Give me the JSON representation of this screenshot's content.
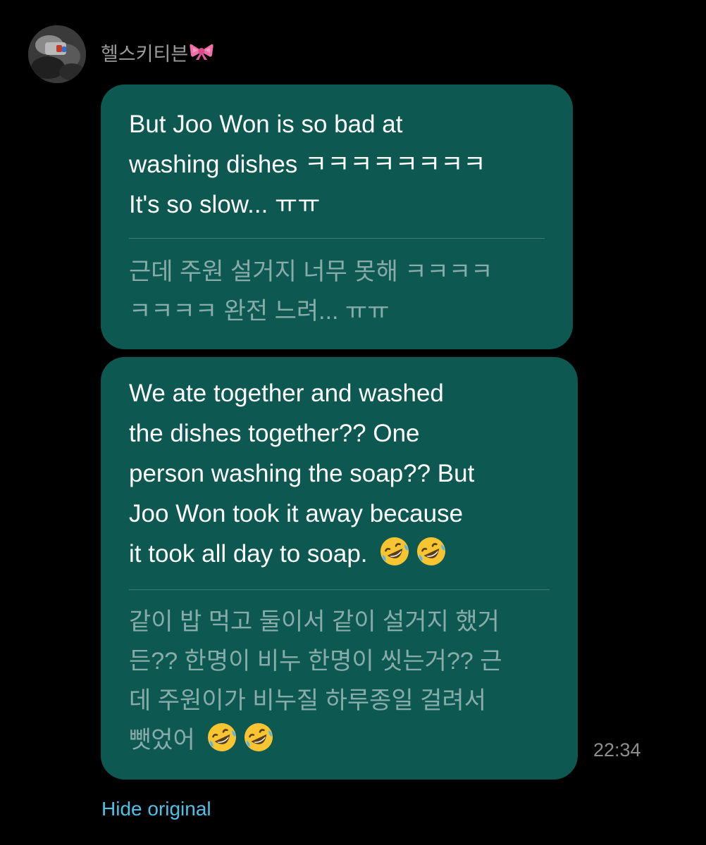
{
  "sender": {
    "name": "헬스키티븐",
    "name_emoji_icon": "ribbon-icon"
  },
  "messages": [
    {
      "translated": "But Joo Won is so bad at\nwashing dishes ㅋㅋㅋㅋㅋㅋㅋㅋ\nIt's so slow... ㅠㅠ",
      "original": "근데 주원 설거지 너무 못해 ㅋㅋㅋㅋ\nㅋㅋㅋㅋ 완전 느려... ㅠㅠ"
    },
    {
      "translated": "We ate together and washed\nthe dishes together?? One\nperson washing the soap?? But\nJoo Won took it away because\nit took all day to soap.",
      "translated_emojis": [
        "rolling-on-floor-laughing-icon",
        "rolling-on-floor-laughing-icon"
      ],
      "original": "같이 밥 먹고 둘이서 같이 설거지 했거\n든?? 한명이 비누 한명이 씻는거?? 근\n데 주원이가 비누질 하루종일 걸려서\n뺏었어",
      "original_emojis": [
        "rolling-on-floor-laughing-icon",
        "rolling-on-floor-laughing-icon"
      ],
      "timestamp": "22:34"
    }
  ],
  "actions": {
    "hide_original_label": "Hide original"
  },
  "colors": {
    "background": "#000000",
    "bubble": "#0e5852",
    "translated_text": "#ffffff",
    "original_text": "rgba(255,255,255,0.50)",
    "link": "#4fc0e6",
    "meta_text": "#9b9b9b"
  }
}
